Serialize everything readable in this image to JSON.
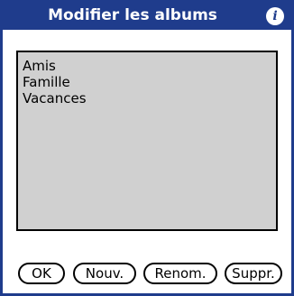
{
  "dialog": {
    "title": "Modifier les albums",
    "info_icon": "info-icon"
  },
  "albums": {
    "items": [
      {
        "label": "Amis"
      },
      {
        "label": "Famille"
      },
      {
        "label": "Vacances"
      }
    ]
  },
  "buttons": {
    "ok": "OK",
    "new": "Nouv.",
    "rename": "Renom.",
    "delete": "Suppr."
  },
  "colors": {
    "accent": "#1f3c8c",
    "list_background": "#d0d0d0"
  }
}
